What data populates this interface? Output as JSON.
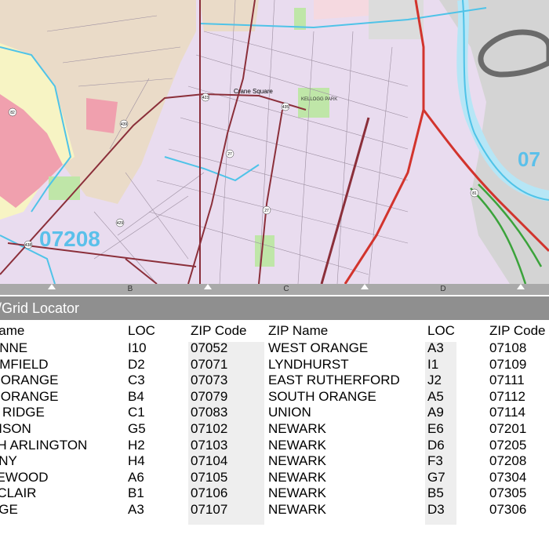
{
  "map": {
    "zip_labels": [
      "07208",
      "07"
    ],
    "place_label": "Crane Square",
    "park_labels": [
      "KELLOGG PARK"
    ],
    "route_shields": [
      "423",
      "435",
      "27",
      "27",
      "429",
      "438",
      "82",
      "439",
      "81"
    ]
  },
  "grid_letters": [
    "B",
    "C",
    "D"
  ],
  "locator": {
    "title": "x/Grid Locator"
  },
  "table": {
    "headers": {
      "name1": "Name",
      "loc1": "LOC",
      "zip1": "ZIP Code",
      "name2": "ZIP Name",
      "loc2": "LOC",
      "zip2": "ZIP Code"
    },
    "left": {
      "names": [
        "ONNE",
        "OMFIELD",
        "T ORANGE",
        "T ORANGE",
        "N RIDGE",
        "RISON",
        "TH ARLINGTON",
        "RNY",
        "LEWOOD",
        "TCLAIR",
        "NGE"
      ],
      "locs": [
        "I10",
        "D2",
        "C3",
        "B4",
        "C1",
        "G5",
        "H2",
        "H4",
        "A6",
        "B1",
        "A3"
      ],
      "zips": [
        "07052",
        "07071",
        "07073",
        "07079",
        "07083",
        "07102",
        "07103",
        "07104",
        "07105",
        "07106",
        "07107"
      ]
    },
    "right": {
      "names": [
        "WEST ORANGE",
        "LYNDHURST",
        "EAST RUTHERFORD",
        "SOUTH ORANGE",
        "UNION",
        "NEWARK",
        "NEWARK",
        "NEWARK",
        "NEWARK",
        "NEWARK",
        "NEWARK"
      ],
      "locs": [
        "A3",
        "I1",
        "J2",
        "A5",
        "A9",
        "E6",
        "D6",
        "F3",
        "G7",
        "B5",
        "D3"
      ],
      "zips": [
        "07108",
        "07109",
        "07111",
        "07112",
        "07114",
        "07201",
        "07205",
        "07208",
        "07304",
        "07305",
        "07306"
      ]
    }
  },
  "colors": {
    "zip_boundary": "#4fc3e8",
    "major_road": "#8b2f3a",
    "highway": "#d2342d",
    "park": "#bfe6a8",
    "residential": "#e9dcef",
    "header": "#8f8f8f"
  }
}
